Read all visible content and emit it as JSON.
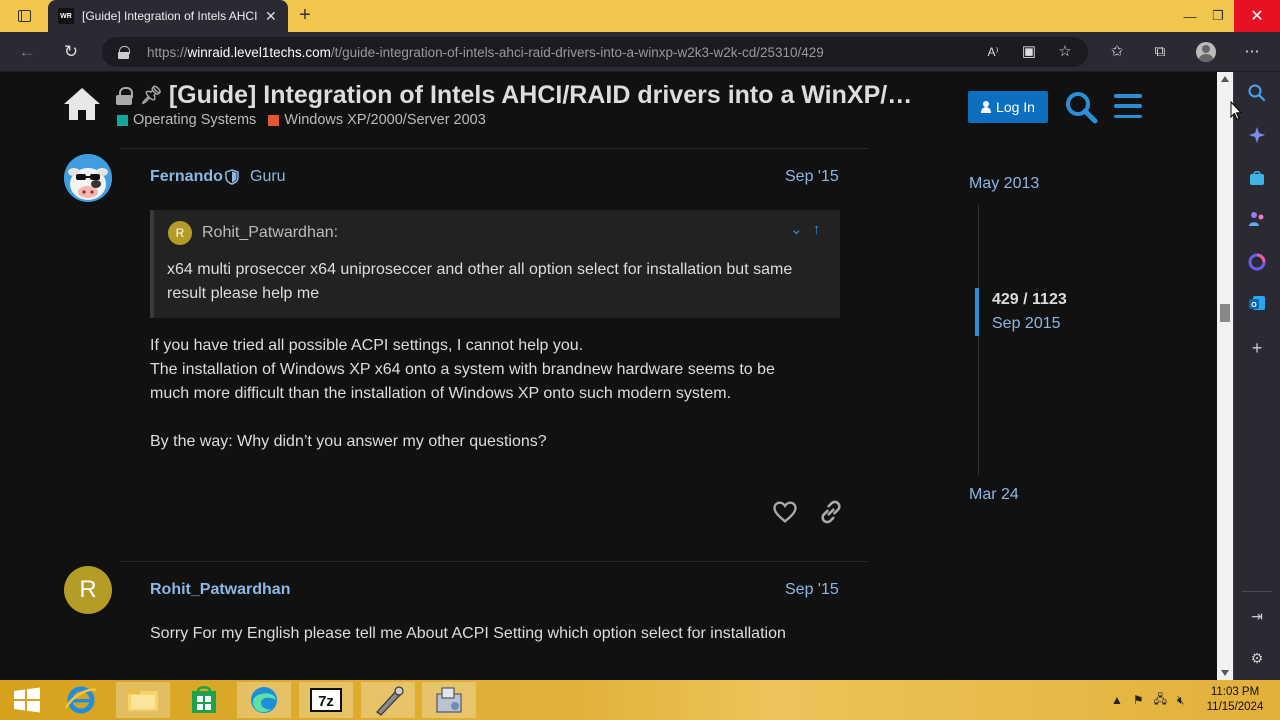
{
  "browser": {
    "tab_title": "[Guide] Integration of Intels AHCI",
    "favicon_text": "WR",
    "url_domain": "winraid.level1techs.com",
    "url_scheme": "https://",
    "url_path": "/t/guide-integration-of-intels-ahci-raid-drivers-into-a-winxp-w2k3-w2k-cd/25310/429"
  },
  "header": {
    "title": "[Guide] Integration of Intels AHCI/RAID drivers into a WinXP/…",
    "categories": [
      {
        "label": "Operating Systems",
        "color": "#12a89d"
      },
      {
        "label": "Windows XP/2000/Server 2003",
        "color": "#e45735"
      }
    ],
    "login_label": "Log In"
  },
  "posts": [
    {
      "username": "Fernando",
      "title": "Guru",
      "date": "Sep '15",
      "quote": {
        "author": "Rohit_Patwardhan:",
        "avatar_letter": "R",
        "text": "x64 multi proseccer x64 uniproseccer and other all option select for installation but same result please help me"
      },
      "body": [
        "If you have tried all possible ACPI settings, I cannot help you.",
        "The installation of Windows XP x64 onto a system with brandnew hardware seems to be",
        "much more difficult than the installation of Windows XP onto such modern system.",
        "",
        "By the way: Why didn’t you answer my other questions?"
      ]
    },
    {
      "username": "Rohit_Patwardhan",
      "avatar_letter": "R",
      "date": "Sep '15",
      "body": [
        "Sorry For my English please tell me About ACPI Setting which option select for installation"
      ]
    }
  ],
  "timeline": {
    "start": "May 2013",
    "position": "429 / 1123",
    "position_date": "Sep 2015",
    "end": "Mar 24"
  },
  "taskbar": {
    "time": "11:03 PM",
    "date": "11/15/2024",
    "apps": [
      "start",
      "internet-explorer",
      "file-explorer",
      "store",
      "edge",
      "7zip",
      "tool",
      "installer"
    ]
  },
  "colors": {
    "accent": "#2b8fd8",
    "link": "#8bb8e2",
    "page_bg": "#111111",
    "titlebar": "#f0c64e"
  }
}
